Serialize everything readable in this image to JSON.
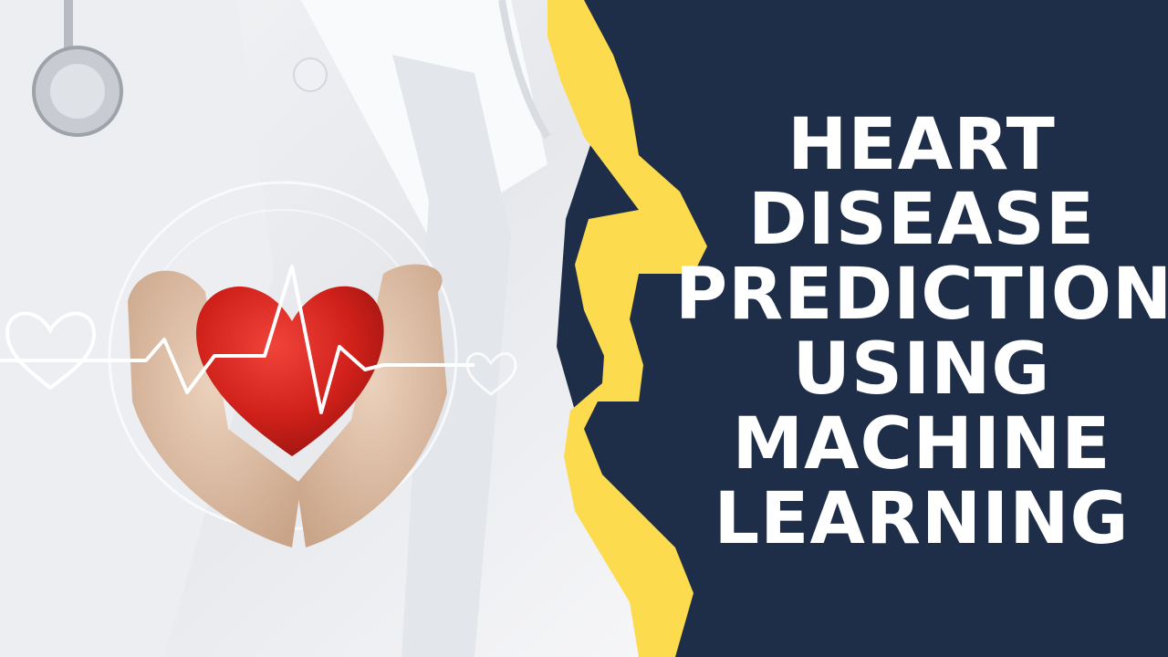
{
  "headline": {
    "lines": [
      "HEART",
      "DISEASE",
      "PREDICTION",
      "USING",
      "MACHINE",
      "LEARNING"
    ]
  },
  "colors": {
    "panel": "#1f2e48",
    "accent_stroke": "#fddb4f",
    "heart": "#d9261c",
    "text": "#ffffff"
  },
  "icons": [
    "stethoscope-icon",
    "heart-outline-icon",
    "heartbeat-line-icon",
    "red-heart-icon"
  ]
}
